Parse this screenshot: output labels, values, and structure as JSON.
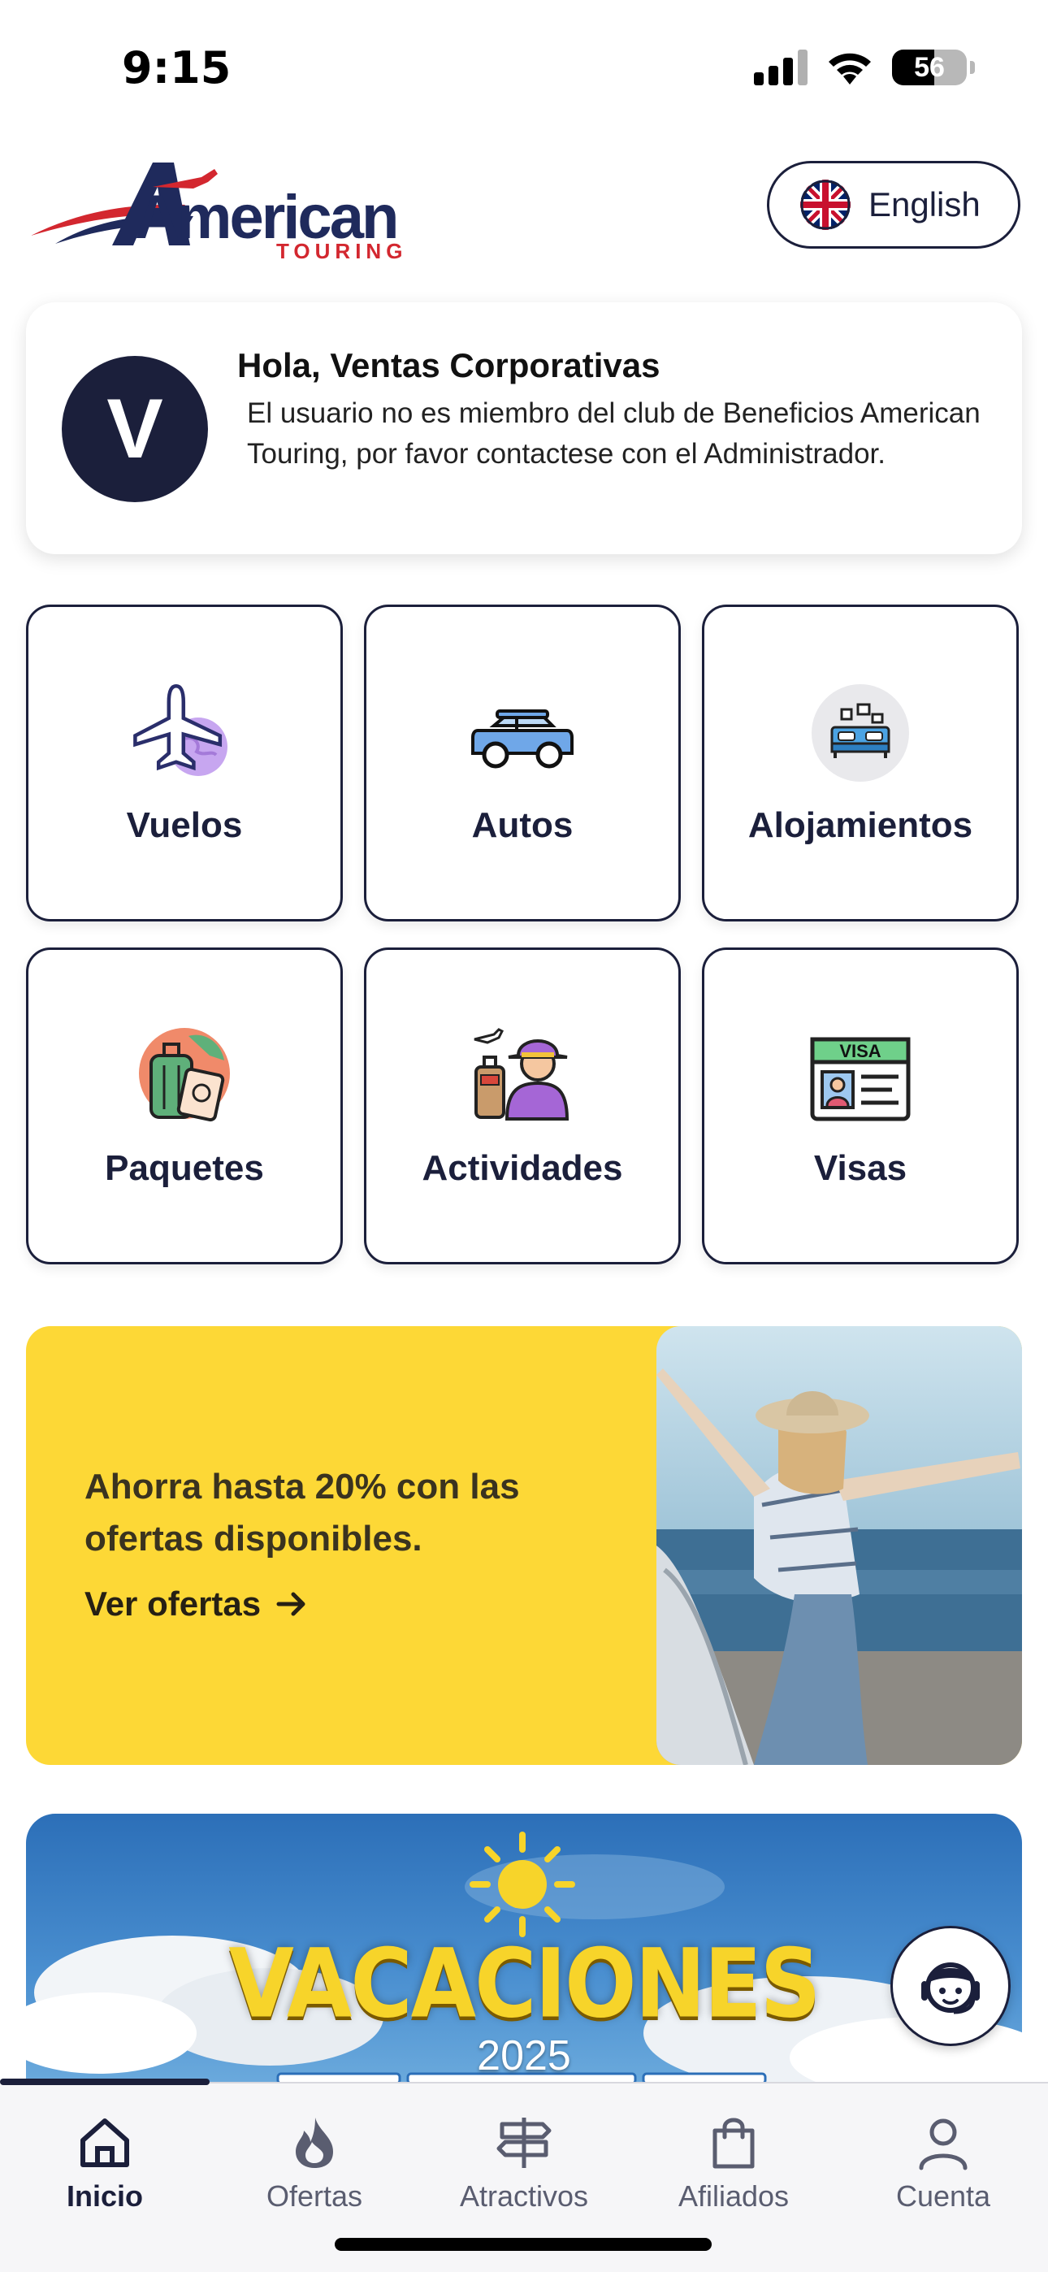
{
  "status_bar": {
    "time": "9:15",
    "battery": "56"
  },
  "header": {
    "logo_text": "American",
    "logo_sub": "TOURING",
    "language_label": "English",
    "language_flag_icon": "uk-flag-icon"
  },
  "greeting": {
    "avatar_initial": "V",
    "title": "Hola, Ventas Corporativas",
    "message": "El usuario no es miembro del club de Beneficios American Touring, por favor contactese con el Administrador."
  },
  "services": [
    {
      "label": "Vuelos",
      "icon": "airplane-globe-icon"
    },
    {
      "label": "Autos",
      "icon": "car-icon"
    },
    {
      "label": "Alojamientos",
      "icon": "hotel-bed-icon"
    },
    {
      "label": "Paquetes",
      "icon": "luggage-passport-icon"
    },
    {
      "label": "Actividades",
      "icon": "traveler-icon"
    },
    {
      "label": "Visas",
      "icon": "visa-card-icon"
    }
  ],
  "promo": {
    "text": "Ahorra hasta 20% con las ofertas disponibles.",
    "link_label": "Ver ofertas",
    "link_icon": "arrow-right-icon",
    "bg_color": "#fdd836"
  },
  "banner": {
    "title": "VACACIONES",
    "year": "2025"
  },
  "bottom_nav": {
    "items": [
      {
        "label": "Inicio",
        "icon": "home-icon",
        "active": true
      },
      {
        "label": "Ofertas",
        "icon": "flame-icon",
        "active": false
      },
      {
        "label": "Atractivos",
        "icon": "signpost-icon",
        "active": false
      },
      {
        "label": "Afiliados",
        "icon": "shopping-bag-icon",
        "active": false
      },
      {
        "label": "Cuenta",
        "icon": "user-icon",
        "active": false
      }
    ]
  },
  "colors": {
    "primary": "#1b1f3b",
    "accent_red": "#d3272f",
    "promo_yellow": "#fdd836"
  }
}
